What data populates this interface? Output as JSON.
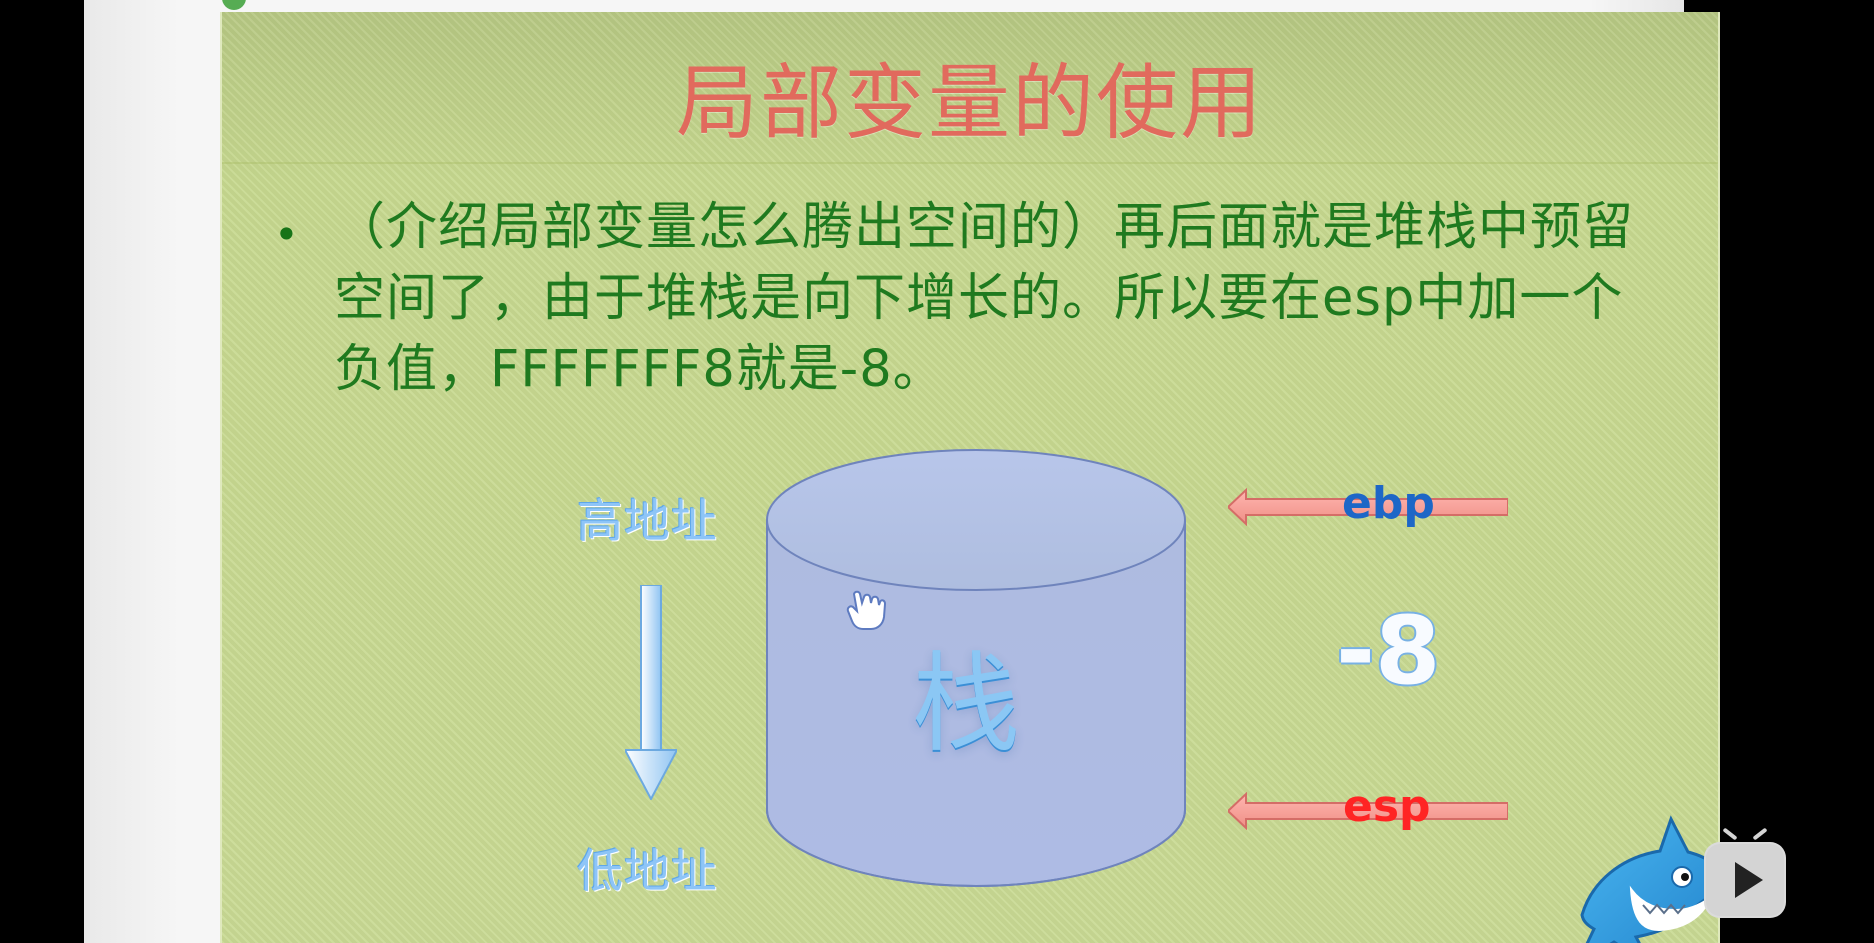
{
  "slide": {
    "title": "局部变量的使用",
    "body_text": "（介绍局部变量怎么腾出空间的）再后面就是堆栈中预留空间了，由于堆栈是向下增长的。所以要在esp中加一个负值，FFFFFFF8就是-8。"
  },
  "diagram": {
    "high_address": "高地址",
    "low_address": "低地址",
    "stack_label": "栈",
    "ebp_label": "ebp",
    "esp_label": "esp",
    "offset": "-8"
  },
  "icons": {
    "bullet": "•",
    "cursor": "cursor-icon",
    "shark": "shark-icon",
    "player": "play-icon"
  },
  "colors": {
    "title": "#e16a5d",
    "body_text": "#1f7a1f",
    "slide_bg": "#c6d88f",
    "ebp": "#1d67c7",
    "esp": "#ff2424",
    "arrow": "#f3a0a0",
    "stack": "#b6c6e6"
  }
}
